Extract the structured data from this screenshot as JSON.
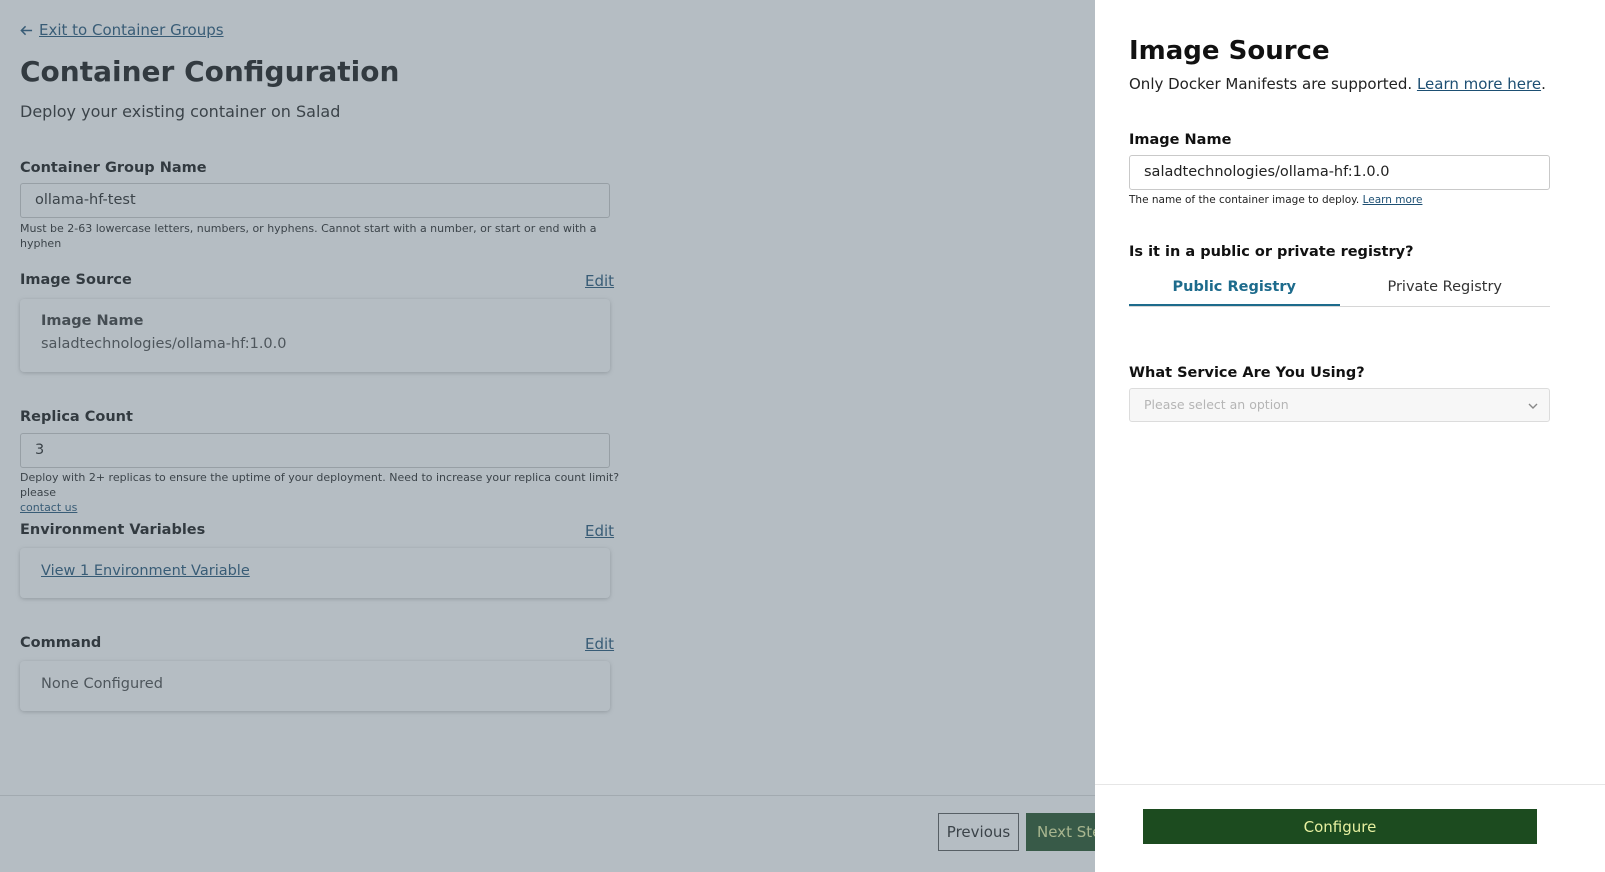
{
  "page": {
    "back_link": "Exit to Container Groups",
    "title": "Container Configuration",
    "subtitle": "Deploy your existing container on Salad",
    "group_name": {
      "label": "Container Group Name",
      "value": "ollama-hf-test",
      "helper": "Must be 2-63 lowercase letters, numbers, or hyphens. Cannot start with a number, or start or end with a hyphen"
    },
    "image_source": {
      "label": "Image Source",
      "edit": "Edit",
      "card_label": "Image Name",
      "card_value": "saladtechnologies/ollama-hf:1.0.0"
    },
    "replica_count": {
      "label": "Replica Count",
      "value": "3",
      "helper": "Deploy with 2+ replicas to ensure the uptime of your deployment. Need to increase your replica count limit? please",
      "helper_link": "contact us"
    },
    "env_vars": {
      "label": "Environment Variables",
      "edit": "Edit",
      "link": "View 1 Environment Variable"
    },
    "command": {
      "label": "Command",
      "edit": "Edit",
      "value": "None Configured"
    },
    "footer": {
      "previous": "Previous",
      "next": "Next Ste"
    }
  },
  "drawer": {
    "title": "Image Source",
    "subtitle": "Only Docker Manifests are supported.",
    "subtitle_link": "Learn more here",
    "subtitle_end": ".",
    "image_name": {
      "label": "Image Name",
      "value": "saladtechnologies/ollama-hf:1.0.0",
      "helper": "The name of the container image to deploy.",
      "helper_link": "Learn more"
    },
    "registry_question": "Is it in a public or private registry?",
    "tabs": [
      "Public Registry",
      "Private Registry"
    ],
    "active_tab": "Public Registry",
    "service": {
      "label": "What Service Are You Using?",
      "placeholder": "Please select an option"
    },
    "configure_button": "Configure"
  },
  "colors": {
    "link": "#1d4f73",
    "primary_button": "#1c4b1f",
    "primary_button_text": "#e6f0a0",
    "active_tab": "#1d6b8c"
  },
  "icons": {
    "back": "arrow-left-icon",
    "select": "chevron-down-icon"
  }
}
